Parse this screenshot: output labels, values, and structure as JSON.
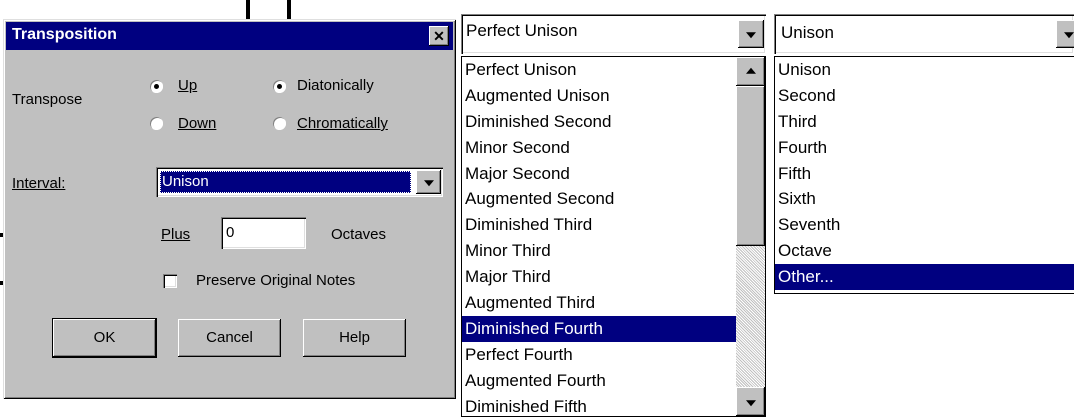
{
  "dialog": {
    "title": "Transposition",
    "transpose_label": "Transpose",
    "direction": {
      "up": "Up",
      "down": "Down",
      "selected": "Up"
    },
    "mode": {
      "diatonic": "Diatonically",
      "chromatic": "Chromatically",
      "selected": "Diatonically"
    },
    "interval_label": "Interval:",
    "interval_value": "Unison",
    "plus_label": "Plus",
    "plus_value": "0",
    "octaves_label": "Octaves",
    "preserve_label": "Preserve Original Notes",
    "preserve_checked": false,
    "ok": "OK",
    "cancel": "Cancel",
    "help": "Help"
  },
  "chromatic_dropdown": {
    "selected": "Perfect Unison",
    "items": [
      "Perfect Unison",
      "Augmented Unison",
      "Diminished Second",
      "Minor Second",
      "Major Second",
      "Augmented Second",
      "Diminished Third",
      "Minor Third",
      "Major Third",
      "Augmented Third",
      "Diminished Fourth",
      "Perfect Fourth",
      "Augmented Fourth",
      "Diminished Fifth"
    ],
    "highlighted_index": 10
  },
  "diatonic_dropdown": {
    "selected": "Unison",
    "items": [
      "Unison",
      "Second",
      "Third",
      "Fourth",
      "Fifth",
      "Sixth",
      "Seventh",
      "Octave",
      "Other..."
    ],
    "highlighted_index": 8
  },
  "colors": {
    "title_bar": "#000080",
    "face": "#c0c0c0",
    "highlight": "#000080"
  }
}
